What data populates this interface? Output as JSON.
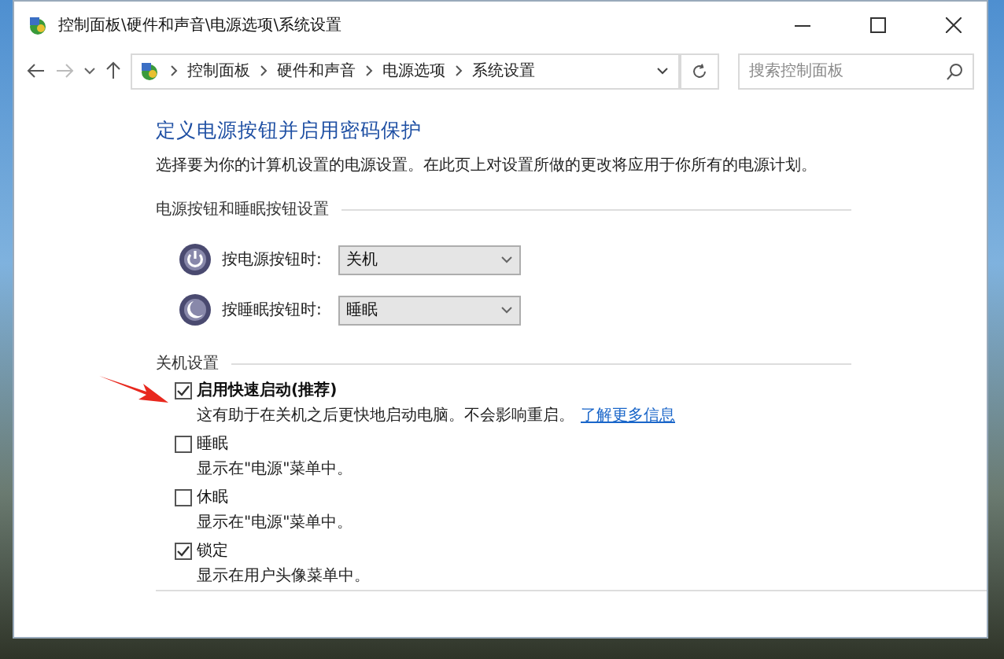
{
  "window": {
    "title": "控制面板\\硬件和声音\\电源选项\\系统设置"
  },
  "address_bar": {
    "crumbs": [
      "控制面板",
      "硬件和声音",
      "电源选项",
      "系统设置"
    ]
  },
  "search": {
    "placeholder": "搜索控制面板"
  },
  "heading": "定义电源按钮并启用密码保护",
  "description": "选择要为你的计算机设置的电源设置。在此页上对设置所做的更改将应用于你所有的电源计划。",
  "button_section": {
    "title": "电源按钮和睡眠按钮设置",
    "rows": [
      {
        "kind": "power",
        "label": "按电源按钮时:",
        "value": "关机"
      },
      {
        "kind": "sleep",
        "label": "按睡眠按钮时:",
        "value": "睡眠"
      }
    ]
  },
  "shutdown_section": {
    "title": "关机设置",
    "options": [
      {
        "label": "启用快速启动(推荐)",
        "checked": true,
        "description": "这有助于在关机之后更快地启动电脑。不会影响重启。",
        "link": "了解更多信息"
      },
      {
        "label": "睡眠",
        "checked": false,
        "description": "显示在\"电源\"菜单中。"
      },
      {
        "label": "休眠",
        "checked": false,
        "description": "显示在\"电源\"菜单中。"
      },
      {
        "label": "锁定",
        "checked": true,
        "description": "显示在用户头像菜单中。"
      }
    ]
  }
}
